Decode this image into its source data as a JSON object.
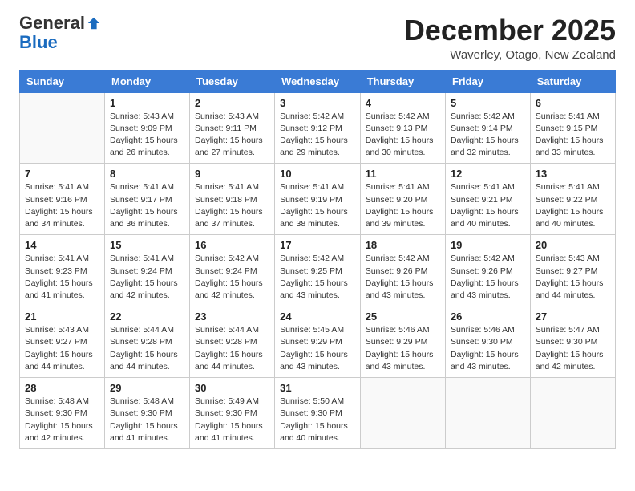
{
  "logo": {
    "general": "General",
    "blue": "Blue"
  },
  "title": "December 2025",
  "location": "Waverley, Otago, New Zealand",
  "days_of_week": [
    "Sunday",
    "Monday",
    "Tuesday",
    "Wednesday",
    "Thursday",
    "Friday",
    "Saturday"
  ],
  "weeks": [
    [
      {
        "day": "",
        "info": ""
      },
      {
        "day": "1",
        "info": "Sunrise: 5:43 AM\nSunset: 9:09 PM\nDaylight: 15 hours\nand 26 minutes."
      },
      {
        "day": "2",
        "info": "Sunrise: 5:43 AM\nSunset: 9:11 PM\nDaylight: 15 hours\nand 27 minutes."
      },
      {
        "day": "3",
        "info": "Sunrise: 5:42 AM\nSunset: 9:12 PM\nDaylight: 15 hours\nand 29 minutes."
      },
      {
        "day": "4",
        "info": "Sunrise: 5:42 AM\nSunset: 9:13 PM\nDaylight: 15 hours\nand 30 minutes."
      },
      {
        "day": "5",
        "info": "Sunrise: 5:42 AM\nSunset: 9:14 PM\nDaylight: 15 hours\nand 32 minutes."
      },
      {
        "day": "6",
        "info": "Sunrise: 5:41 AM\nSunset: 9:15 PM\nDaylight: 15 hours\nand 33 minutes."
      }
    ],
    [
      {
        "day": "7",
        "info": "Sunrise: 5:41 AM\nSunset: 9:16 PM\nDaylight: 15 hours\nand 34 minutes."
      },
      {
        "day": "8",
        "info": "Sunrise: 5:41 AM\nSunset: 9:17 PM\nDaylight: 15 hours\nand 36 minutes."
      },
      {
        "day": "9",
        "info": "Sunrise: 5:41 AM\nSunset: 9:18 PM\nDaylight: 15 hours\nand 37 minutes."
      },
      {
        "day": "10",
        "info": "Sunrise: 5:41 AM\nSunset: 9:19 PM\nDaylight: 15 hours\nand 38 minutes."
      },
      {
        "day": "11",
        "info": "Sunrise: 5:41 AM\nSunset: 9:20 PM\nDaylight: 15 hours\nand 39 minutes."
      },
      {
        "day": "12",
        "info": "Sunrise: 5:41 AM\nSunset: 9:21 PM\nDaylight: 15 hours\nand 40 minutes."
      },
      {
        "day": "13",
        "info": "Sunrise: 5:41 AM\nSunset: 9:22 PM\nDaylight: 15 hours\nand 40 minutes."
      }
    ],
    [
      {
        "day": "14",
        "info": "Sunrise: 5:41 AM\nSunset: 9:23 PM\nDaylight: 15 hours\nand 41 minutes."
      },
      {
        "day": "15",
        "info": "Sunrise: 5:41 AM\nSunset: 9:24 PM\nDaylight: 15 hours\nand 42 minutes."
      },
      {
        "day": "16",
        "info": "Sunrise: 5:42 AM\nSunset: 9:24 PM\nDaylight: 15 hours\nand 42 minutes."
      },
      {
        "day": "17",
        "info": "Sunrise: 5:42 AM\nSunset: 9:25 PM\nDaylight: 15 hours\nand 43 minutes."
      },
      {
        "day": "18",
        "info": "Sunrise: 5:42 AM\nSunset: 9:26 PM\nDaylight: 15 hours\nand 43 minutes."
      },
      {
        "day": "19",
        "info": "Sunrise: 5:42 AM\nSunset: 9:26 PM\nDaylight: 15 hours\nand 43 minutes."
      },
      {
        "day": "20",
        "info": "Sunrise: 5:43 AM\nSunset: 9:27 PM\nDaylight: 15 hours\nand 44 minutes."
      }
    ],
    [
      {
        "day": "21",
        "info": "Sunrise: 5:43 AM\nSunset: 9:27 PM\nDaylight: 15 hours\nand 44 minutes."
      },
      {
        "day": "22",
        "info": "Sunrise: 5:44 AM\nSunset: 9:28 PM\nDaylight: 15 hours\nand 44 minutes."
      },
      {
        "day": "23",
        "info": "Sunrise: 5:44 AM\nSunset: 9:28 PM\nDaylight: 15 hours\nand 44 minutes."
      },
      {
        "day": "24",
        "info": "Sunrise: 5:45 AM\nSunset: 9:29 PM\nDaylight: 15 hours\nand 43 minutes."
      },
      {
        "day": "25",
        "info": "Sunrise: 5:46 AM\nSunset: 9:29 PM\nDaylight: 15 hours\nand 43 minutes."
      },
      {
        "day": "26",
        "info": "Sunrise: 5:46 AM\nSunset: 9:30 PM\nDaylight: 15 hours\nand 43 minutes."
      },
      {
        "day": "27",
        "info": "Sunrise: 5:47 AM\nSunset: 9:30 PM\nDaylight: 15 hours\nand 42 minutes."
      }
    ],
    [
      {
        "day": "28",
        "info": "Sunrise: 5:48 AM\nSunset: 9:30 PM\nDaylight: 15 hours\nand 42 minutes."
      },
      {
        "day": "29",
        "info": "Sunrise: 5:48 AM\nSunset: 9:30 PM\nDaylight: 15 hours\nand 41 minutes."
      },
      {
        "day": "30",
        "info": "Sunrise: 5:49 AM\nSunset: 9:30 PM\nDaylight: 15 hours\nand 41 minutes."
      },
      {
        "day": "31",
        "info": "Sunrise: 5:50 AM\nSunset: 9:30 PM\nDaylight: 15 hours\nand 40 minutes."
      },
      {
        "day": "",
        "info": ""
      },
      {
        "day": "",
        "info": ""
      },
      {
        "day": "",
        "info": ""
      }
    ]
  ]
}
